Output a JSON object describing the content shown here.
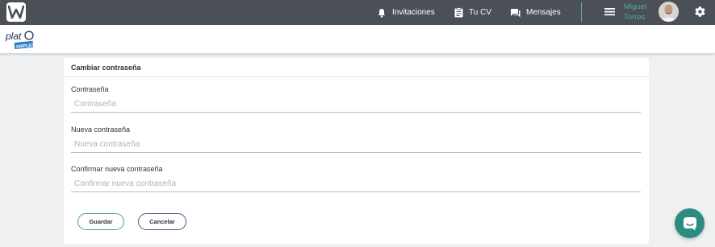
{
  "nav": {
    "invitations_label": "Invitaciones",
    "cv_label": "Tu CV",
    "messages_label": "Mensajes",
    "user_first_name": "Miguel",
    "user_last_name": "Torres",
    "icons": [
      "bell-icon",
      "clipboard-icon",
      "chat-icon",
      "menu-icon",
      "gear-icon"
    ]
  },
  "brand": {
    "logo_text": "plat",
    "logo_tag": "EMPLEO"
  },
  "form": {
    "title": "Cambiar contraseña",
    "current_label": "Contraseña",
    "current_placeholder": "Contraseña",
    "new_label": "Nueva contraseña",
    "new_placeholder": "Nueva contraseña",
    "confirm_label": "Confirmar nueva contraseña",
    "confirm_placeholder": "Confirmar nueva contraseña",
    "save_label": "Guardar",
    "cancel_label": "Cancelar"
  },
  "colors": {
    "topbar": "#4a4f58",
    "accent": "#4fae8e",
    "chat_fab": "#2c8c80"
  }
}
